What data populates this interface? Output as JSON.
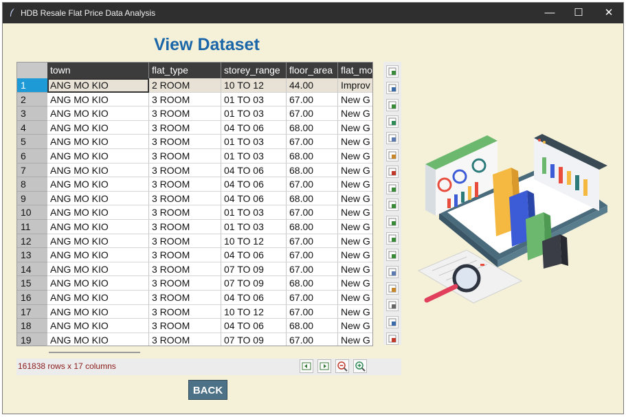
{
  "window": {
    "title": "HDB Resale Flat Price Data Analysis",
    "minimize": "—",
    "maximize": "☐",
    "close": "✕"
  },
  "page": {
    "heading": "View Dataset",
    "row_count": "161838 rows x 17 columns",
    "back_label": "BACK"
  },
  "table": {
    "columns": [
      "town",
      "flat_type",
      "storey_range",
      "floor_area",
      "flat_mo"
    ],
    "rows": [
      [
        "1",
        "ANG MO KIO",
        "2 ROOM",
        "10 TO 12",
        "44.00",
        "Improv"
      ],
      [
        "2",
        "ANG MO KIO",
        "3 ROOM",
        "01 TO 03",
        "67.00",
        "New G"
      ],
      [
        "3",
        "ANG MO KIO",
        "3 ROOM",
        "01 TO 03",
        "67.00",
        "New G"
      ],
      [
        "4",
        "ANG MO KIO",
        "3 ROOM",
        "04 TO 06",
        "68.00",
        "New G"
      ],
      [
        "5",
        "ANG MO KIO",
        "3 ROOM",
        "01 TO 03",
        "67.00",
        "New G"
      ],
      [
        "6",
        "ANG MO KIO",
        "3 ROOM",
        "01 TO 03",
        "68.00",
        "New G"
      ],
      [
        "7",
        "ANG MO KIO",
        "3 ROOM",
        "04 TO 06",
        "68.00",
        "New G"
      ],
      [
        "8",
        "ANG MO KIO",
        "3 ROOM",
        "04 TO 06",
        "67.00",
        "New G"
      ],
      [
        "9",
        "ANG MO KIO",
        "3 ROOM",
        "04 TO 06",
        "68.00",
        "New G"
      ],
      [
        "10",
        "ANG MO KIO",
        "3 ROOM",
        "01 TO 03",
        "67.00",
        "New G"
      ],
      [
        "11",
        "ANG MO KIO",
        "3 ROOM",
        "01 TO 03",
        "68.00",
        "New G"
      ],
      [
        "12",
        "ANG MO KIO",
        "3 ROOM",
        "10 TO 12",
        "67.00",
        "New G"
      ],
      [
        "13",
        "ANG MO KIO",
        "3 ROOM",
        "04 TO 06",
        "67.00",
        "New G"
      ],
      [
        "14",
        "ANG MO KIO",
        "3 ROOM",
        "07 TO 09",
        "67.00",
        "New G"
      ],
      [
        "15",
        "ANG MO KIO",
        "3 ROOM",
        "07 TO 09",
        "68.00",
        "New G"
      ],
      [
        "16",
        "ANG MO KIO",
        "3 ROOM",
        "04 TO 06",
        "67.00",
        "New G"
      ],
      [
        "17",
        "ANG MO KIO",
        "3 ROOM",
        "10 TO 12",
        "67.00",
        "New G"
      ],
      [
        "18",
        "ANG MO KIO",
        "3 ROOM",
        "04 TO 06",
        "68.00",
        "New G"
      ],
      [
        "19",
        "ANG MO KIO",
        "3 ROOM",
        "07 TO 09",
        "67.00",
        "New G"
      ]
    ]
  },
  "toolbar_icons": [
    "load-table-icon",
    "save-table-icon",
    "import-csv-icon",
    "import-excel-icon",
    "copy-icon",
    "paste-icon",
    "plot-icon",
    "transform-icon",
    "merge-icon",
    "pivot-icon",
    "join-icon",
    "aggregate-icon",
    "duplicate-icon",
    "summary-icon",
    "calculator-icon",
    "chart-icon",
    "report-icon"
  ],
  "nav_icons": [
    "prev-page-icon",
    "next-page-icon",
    "zoom-out-icon",
    "zoom-in-icon"
  ],
  "colors": {
    "heading": "#1b66a8",
    "selected_row_header": "#1e9ad6",
    "column_header": "#3c3c3c",
    "row_count": "#8b1a1a",
    "back_button": "#4d7287"
  }
}
